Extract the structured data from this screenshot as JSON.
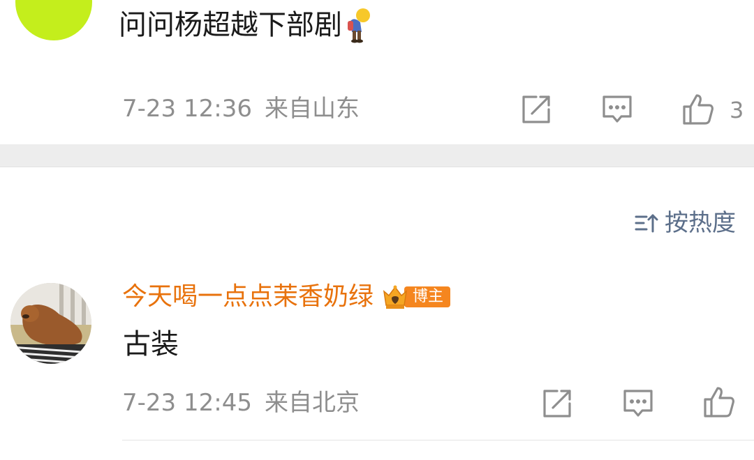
{
  "comments": [
    {
      "text": "问问杨超越下部剧",
      "inline_emoji": "bow-emoji",
      "avatar_color": "#c4ee1c",
      "time": "7-23 12:36",
      "location": "来自山东",
      "like_count": "3"
    },
    {
      "username": "今天喝一点点茉香奶绿",
      "badge_label": "博主",
      "text": "古装",
      "avatar": "dog-photo-avatar",
      "time": "7-23 12:45",
      "location": "来自北京",
      "like_count": ""
    }
  ],
  "sort": {
    "label": "按热度",
    "icon": "sort-icon"
  },
  "actions": {
    "icons": [
      "share-icon",
      "comment-icon",
      "like-icon"
    ]
  },
  "colors": {
    "username": "#e8720c",
    "badge": "#f5861f",
    "meta": "#8e8e8e",
    "sort": "#5c6f8a",
    "separator": "#ededed"
  }
}
